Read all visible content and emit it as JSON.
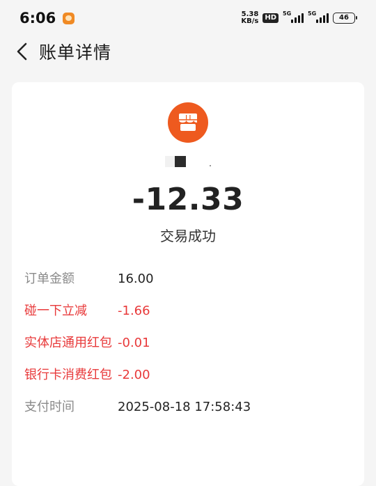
{
  "status_bar": {
    "time": "6:06",
    "net_speed_value": "5.38",
    "net_speed_unit": "KB/s",
    "hd_label": "HD",
    "sim1_label": "5G",
    "sim2_label": "5G",
    "battery": "46"
  },
  "header": {
    "title": "账单详情"
  },
  "transaction": {
    "amount": "-12.33",
    "status": "交易成功"
  },
  "details": [
    {
      "label": "订单金额",
      "value": "16.00",
      "highlight": false
    },
    {
      "label": "碰一下立减",
      "value": "-1.66",
      "highlight": true
    },
    {
      "label": "实体店通用红包",
      "value": "-0.01",
      "highlight": true
    },
    {
      "label": "银行卡消费红包",
      "value": "-2.00",
      "highlight": true
    },
    {
      "label": "支付时间",
      "value": "2025-08-18 17:58:43",
      "highlight": false
    }
  ],
  "colors": {
    "accent_orange": "#ee5a1f",
    "discount_red": "#e8393a"
  },
  "icons": {
    "back": "chevron-left-icon",
    "merchant": "store-icon"
  }
}
